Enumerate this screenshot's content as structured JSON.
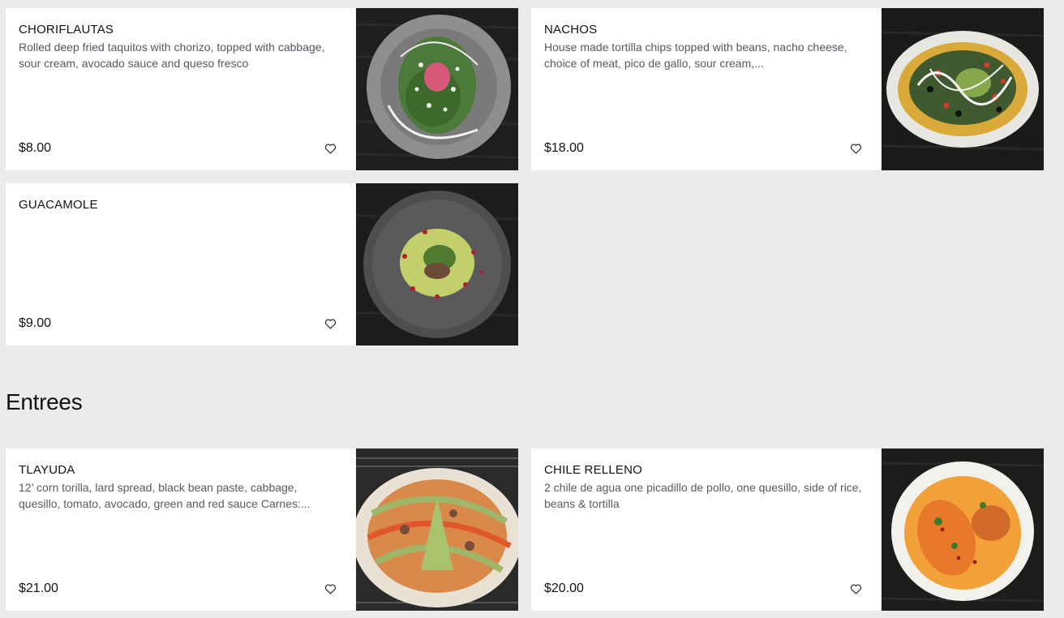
{
  "sections": [
    {
      "items": [
        {
          "name": "CHORIFLAUTAS",
          "description": "Rolled deep fried taquitos with chorizo, topped with cabbage, sour cream, avocado sauce and queso fresco",
          "price": "$8.00"
        },
        {
          "name": "NACHOS",
          "description": "House made tortilla chips topped with beans, nacho cheese, choice of meat, pico de gallo, sour cream,...",
          "price": "$18.00"
        },
        {
          "name": "GUACAMOLE",
          "description": "",
          "price": "$9.00"
        }
      ]
    },
    {
      "title": "Entrees",
      "items": [
        {
          "name": "TLAYUDA",
          "description": "12’ corn torilla, lard spread, black bean paste, cabbage, quesillo, tomato, avocado, green and red sauce Carnes:...",
          "price": "$21.00"
        },
        {
          "name": "CHILE RELLENO",
          "description": "2 chile de agua one picadillo de pollo, one quesillo, side of rice, beans & tortilla",
          "price": "$20.00"
        }
      ]
    }
  ],
  "icons": {
    "favorite": "heart-outline-icon"
  },
  "colors": {
    "background": "#ebebeb",
    "card": "#ffffff",
    "text": "#111111",
    "muted_text": "#555a60"
  }
}
